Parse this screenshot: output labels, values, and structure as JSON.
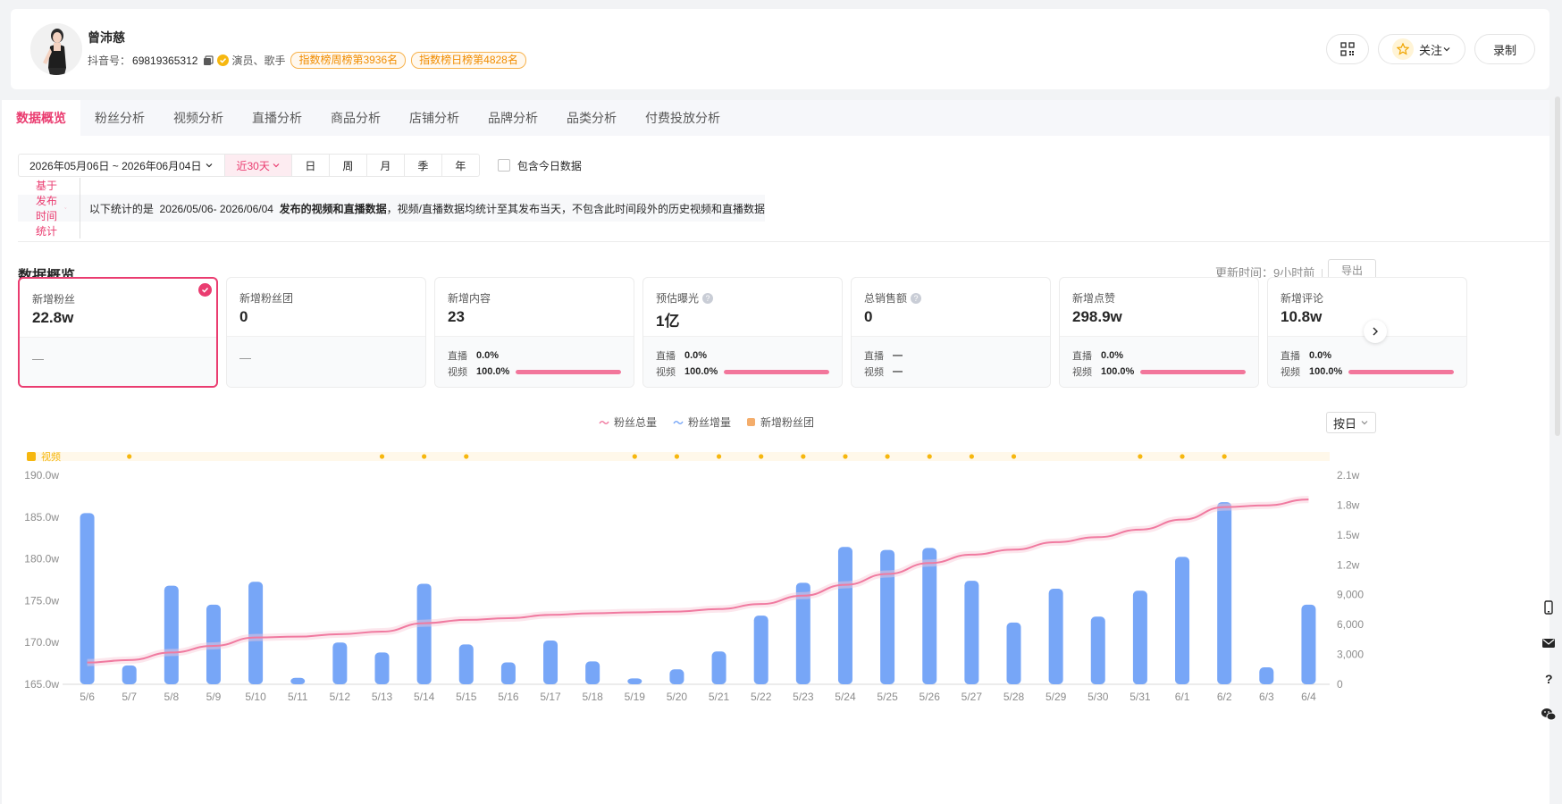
{
  "profile": {
    "name": "曾沛慈",
    "dy_label": "抖音号：",
    "dy_id": "69819365312",
    "tags": "演员、歌手",
    "rank_week": "指数榜周榜第3936名",
    "rank_day": "指数榜日榜第4828名"
  },
  "header": {
    "follow_label": "关注",
    "record_label": "录制"
  },
  "tabs": [
    "数据概览",
    "粉丝分析",
    "视频分析",
    "直播分析",
    "商品分析",
    "店铺分析",
    "品牌分析",
    "品类分析",
    "付费投放分析"
  ],
  "toolbar": {
    "date_range": "2026年05月06日 ~ 2026年06月04日",
    "recent": "近30天",
    "periods": [
      "日",
      "周",
      "月",
      "季",
      "年"
    ],
    "include_today": "包含今日数据"
  },
  "notice": {
    "selector": "基于发布时间统计",
    "prefix": "以下统计的是",
    "range": "2026/05/06- 2026/06/04",
    "bold": "发布的视频和直播数据",
    "suffix": "，视频/直播数据均统计至其发布当天，不包含此时间段外的历史视频和直播数据"
  },
  "overview": {
    "title": "数据概览",
    "update_time": "更新时间：9小时前",
    "export_label": "导出",
    "live_label": "直播",
    "video_label": "视频",
    "dash": "—",
    "metrics": [
      {
        "label": "新增粉丝",
        "value": "22.8w",
        "help": false,
        "selected": true,
        "mode": "dash"
      },
      {
        "label": "新增粉丝团",
        "value": "0",
        "help": false,
        "selected": false,
        "mode": "dash"
      },
      {
        "label": "新增内容",
        "value": "23",
        "help": false,
        "selected": false,
        "mode": "split",
        "live": "0.0%",
        "video": "100.0%",
        "video_share": 1.0
      },
      {
        "label": "预估曝光",
        "value": "1亿",
        "help": true,
        "selected": false,
        "mode": "split",
        "live": "0.0%",
        "video": "100.0%",
        "video_share": 1.0
      },
      {
        "label": "总销售额",
        "value": "0",
        "help": true,
        "selected": false,
        "mode": "splitdash",
        "live": "—",
        "video": "—"
      },
      {
        "label": "新增点赞",
        "value": "298.9w",
        "help": false,
        "selected": false,
        "mode": "split",
        "live": "0.0%",
        "video": "100.0%",
        "video_share": 1.0
      },
      {
        "label": "新增评论",
        "value": "10.8w",
        "help": false,
        "selected": false,
        "mode": "split",
        "live": "0.0%",
        "video": "100.0%",
        "video_share": 1.0
      }
    ]
  },
  "chart_controls": {
    "by_day": "按日"
  },
  "colors": {
    "accent": "#ea3c70",
    "bar": "#77a6f7",
    "line": "#f07aa0",
    "marker": "#f6b70f"
  },
  "chart_data": {
    "type": "bar",
    "legend": [
      "粉丝总量",
      "粉丝增量",
      "新增粉丝团"
    ],
    "video_track_label": "视频",
    "video_marker_days": [
      "5/7",
      "5/13",
      "5/14",
      "5/15",
      "5/19",
      "5/20",
      "5/21",
      "5/22",
      "5/23",
      "5/24",
      "5/25",
      "5/26",
      "5/27",
      "5/28",
      "5/31",
      "6/1",
      "6/2"
    ],
    "categories": [
      "5/6",
      "5/7",
      "5/8",
      "5/9",
      "5/10",
      "5/11",
      "5/12",
      "5/13",
      "5/14",
      "5/15",
      "5/16",
      "5/17",
      "5/18",
      "5/19",
      "5/20",
      "5/21",
      "5/22",
      "5/23",
      "5/24",
      "5/25",
      "5/26",
      "5/27",
      "5/28",
      "5/29",
      "5/30",
      "5/31",
      "6/1",
      "6/2",
      "6/3",
      "6/4"
    ],
    "y_left": {
      "ticks": [
        "165.0w",
        "170.0w",
        "175.0w",
        "180.0w",
        "185.0w",
        "190.0w"
      ],
      "range": [
        165.0,
        190.0
      ]
    },
    "y_right": {
      "ticks": [
        "0",
        "3,000",
        "6,000",
        "9,000",
        "1.2w",
        "1.5w",
        "1.8w",
        "2.1w"
      ],
      "range": [
        0,
        21000
      ]
    },
    "series": [
      {
        "name": "粉丝增量",
        "axis": "right",
        "values": [
          17200,
          1900,
          9900,
          8000,
          10300,
          650,
          4200,
          3200,
          10100,
          4000,
          2200,
          4400,
          2300,
          600,
          1500,
          3300,
          6900,
          10200,
          13800,
          13500,
          13700,
          10400,
          6200,
          9600,
          6800,
          9400,
          12800,
          18300,
          1700,
          8000
        ]
      },
      {
        "name": "粉丝总量",
        "axis": "left",
        "values": [
          167.6,
          167.9,
          168.8,
          169.6,
          170.6,
          170.7,
          171.0,
          171.3,
          172.3,
          172.7,
          172.9,
          173.3,
          173.5,
          173.6,
          173.7,
          174.0,
          174.6,
          175.6,
          176.9,
          178.2,
          179.5,
          180.5,
          181.1,
          182.0,
          182.6,
          183.5,
          184.7,
          186.2,
          186.4,
          187.1
        ]
      }
    ]
  }
}
